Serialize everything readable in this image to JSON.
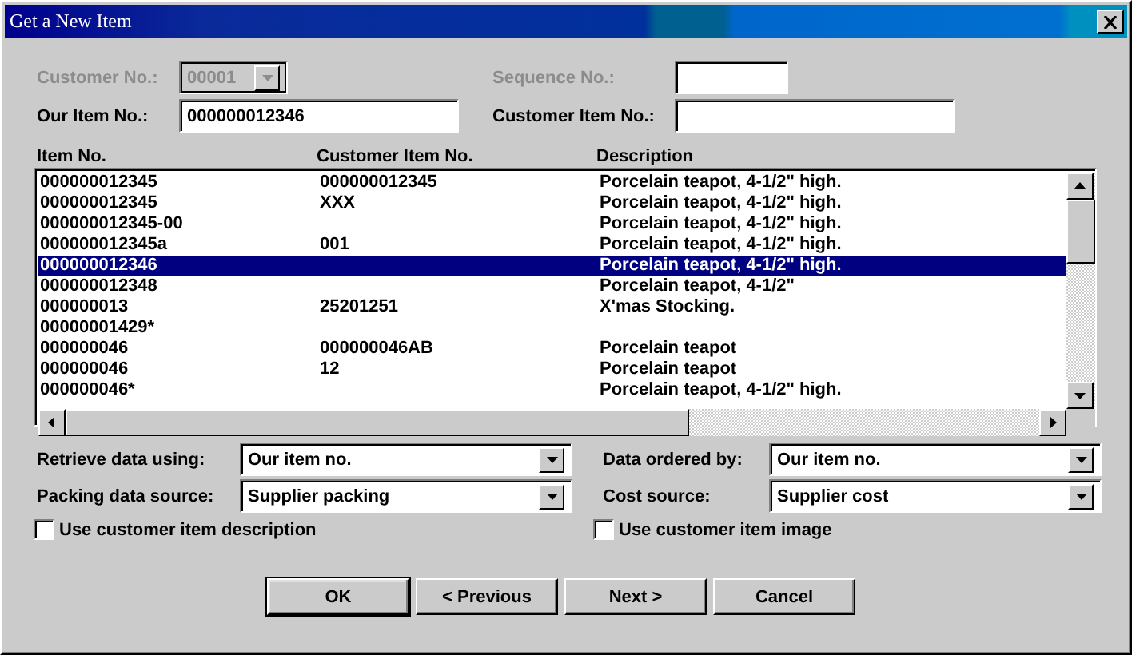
{
  "window": {
    "title": "Get a New Item"
  },
  "fields": [
    {
      "label": "Customer No.:",
      "value": "00001",
      "kind": "combo",
      "disabled": true
    },
    {
      "label": "Sequence No.:",
      "kind": "text",
      "disabled": true
    },
    {
      "label": "Our Item No.:",
      "value": "000000012346",
      "kind": "text",
      "disabled": false
    },
    {
      "label": "Customer Item No.:",
      "kind": "text",
      "disabled": false
    }
  ],
  "table": {
    "columns": [
      "Item No.",
      "Customer Item No.",
      "Description"
    ],
    "rows": [
      {
        "cells": [
          "000000012345",
          "000000012345",
          "Porcelain teapot, 4-1/2\" high."
        ],
        "selected": false
      },
      {
        "cells": [
          "000000012345",
          "XXX",
          "Porcelain teapot, 4-1/2\" high."
        ],
        "selected": false
      },
      {
        "cells": [
          "000000012345-00",
          "",
          "Porcelain teapot, 4-1/2\" high."
        ],
        "selected": false
      },
      {
        "cells": [
          "000000012345a",
          "001",
          "Porcelain teapot, 4-1/2\" high."
        ],
        "selected": false
      },
      {
        "cells": [
          "000000012346",
          "",
          "Porcelain teapot, 4-1/2\" high."
        ],
        "selected": true
      },
      {
        "cells": [
          "000000012348",
          "",
          "Porcelain teapot, 4-1/2\""
        ],
        "selected": false
      },
      {
        "cells": [
          "000000013",
          "25201251",
          "X'mas Stocking."
        ],
        "selected": false
      },
      {
        "cells": [
          "00000001429*",
          "",
          ""
        ],
        "selected": false
      },
      {
        "cells": [
          "000000046",
          "000000046AB",
          "Porcelain teapot"
        ],
        "selected": false
      },
      {
        "cells": [
          "000000046",
          "12",
          "Porcelain teapot"
        ],
        "selected": false
      },
      {
        "cells": [
          "000000046*",
          "",
          "Porcelain teapot, 4-1/2\" high."
        ],
        "selected": false
      }
    ]
  },
  "options": [
    {
      "label": "Retrieve data using:",
      "value": "Our item no."
    },
    {
      "label": "Data ordered by:",
      "value": "Our item no."
    },
    {
      "label": "Packing data source:",
      "value": "Supplier packing"
    },
    {
      "label": "Cost source:",
      "value": "Supplier cost"
    }
  ],
  "checkboxes": [
    {
      "label": "Use customer item description",
      "checked": false
    },
    {
      "label": "Use customer item image",
      "checked": false
    }
  ],
  "buttons": [
    {
      "label": "OK",
      "default": true
    },
    {
      "label": "< Previous",
      "default": false
    },
    {
      "label": "Next >",
      "default": false
    },
    {
      "label": "Cancel",
      "default": false
    }
  ]
}
